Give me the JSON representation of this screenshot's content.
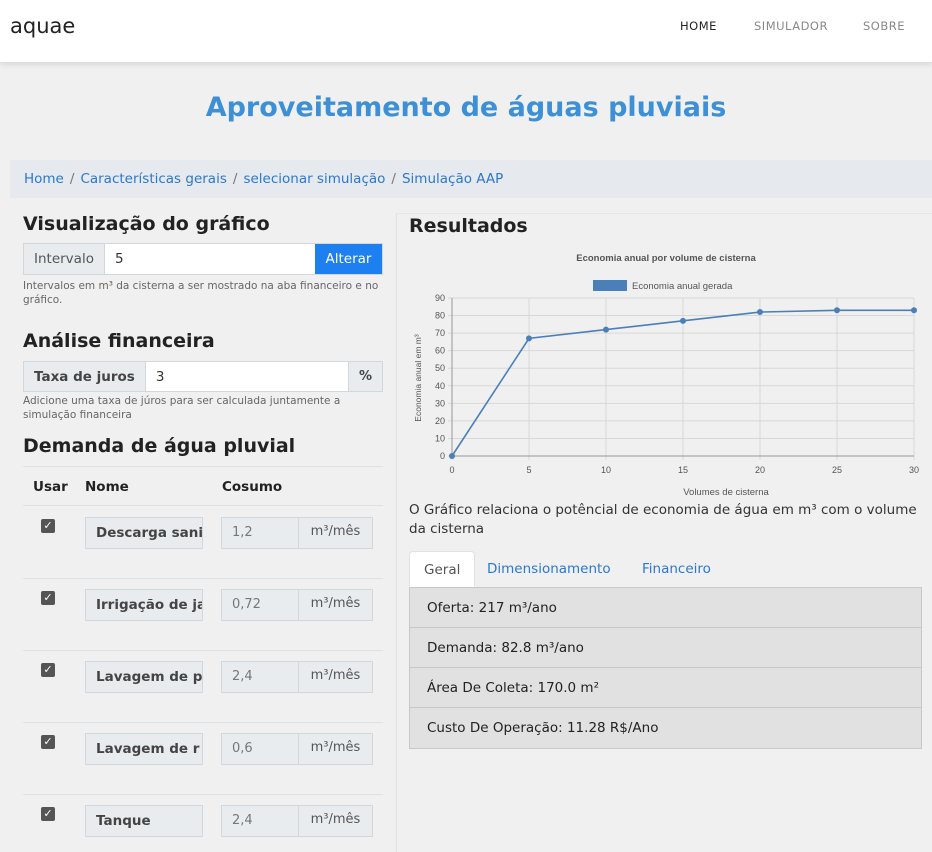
{
  "navbar": {
    "brand": "aquae",
    "links": [
      "HOME",
      "SIMULADOR",
      "SOBRE"
    ]
  },
  "hero": {
    "title": "Aproveitamento de águas pluviais"
  },
  "breadcrumb": [
    "Home",
    "Características gerais",
    "selecionar simulação",
    "Simulação AAP"
  ],
  "visualizacao": {
    "title": "Visualização do gráfico",
    "prepend": "Intervalo",
    "value": "5",
    "button": "Alterar",
    "help": "Intervalos em m³ da cisterna a ser mostrado na aba financeiro e no gráfico."
  },
  "financeira": {
    "title": "Análise financeira",
    "prepend": "Taxa de juros",
    "value": "3",
    "append": "%",
    "help": "Adicione uma taxa de júros para ser calculada juntamente a simulação financeira"
  },
  "demanda": {
    "title": "Demanda de água pluvial",
    "headers": [
      "Usar",
      "Nome",
      "Cosumo"
    ],
    "rows": [
      {
        "name": "Descarga sani",
        "value": "1,2",
        "unit": "m³/mês"
      },
      {
        "name": "Irrigação de ja",
        "value": "0,72",
        "unit": "m³/mês"
      },
      {
        "name": "Lavagem de p",
        "value": "2,4",
        "unit": "m³/mês"
      },
      {
        "name": "Lavagem de r",
        "value": "0,6",
        "unit": "m³/mês"
      },
      {
        "name": "Tanque",
        "value": "2,4",
        "unit": "m³/mês"
      }
    ]
  },
  "resultados": {
    "title": "Resultados",
    "caption": "O Gráfico relaciona o potêncial de economia de água em m³ com o volume da cisterna",
    "tabs": [
      "Geral",
      "Dimensionamento",
      "Financeiro"
    ],
    "items": [
      "Oferta: 217 m³/ano",
      "Demanda: 82.8 m³/ano",
      "Área De Coleta: 170.0 m²",
      "Custo De Operação: 11.28 R$/Ano"
    ]
  },
  "colors": {
    "accent": "#3d8fd6",
    "button": "#1e7ff0",
    "series": "#4a7fb8"
  },
  "chart_data": {
    "type": "line",
    "title": "Economia anual por volume de cisterna",
    "xlabel": "Volumes de cisterna",
    "ylabel": "Economia anual em m³",
    "x": [
      0,
      5,
      10,
      15,
      20,
      25,
      30
    ],
    "series": [
      {
        "name": "Economia anual gerada",
        "values": [
          0,
          67,
          72,
          77,
          82,
          83,
          83
        ]
      }
    ],
    "xlim": [
      0,
      30
    ],
    "ylim": [
      0,
      90
    ],
    "yticks": [
      0,
      10,
      20,
      30,
      40,
      50,
      60,
      70,
      80,
      90
    ],
    "grid": true,
    "legend": "top"
  }
}
